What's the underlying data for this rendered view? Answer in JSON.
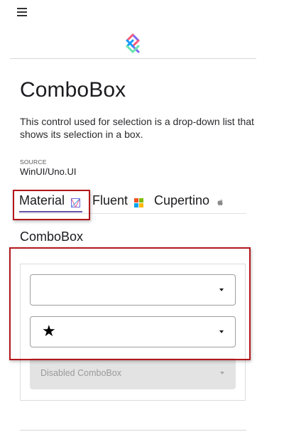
{
  "header": {
    "menu_icon": "hamburger-icon",
    "logo_icon": "uno-platform-logo"
  },
  "page": {
    "title": "ComboBox",
    "description": "This control used for selection is a drop-down list that shows its selection in a box.",
    "source_label": "SOURCE",
    "source_value": "WinUI/Uno.UI"
  },
  "tabs": [
    {
      "label": "Material",
      "icon": "material-icon",
      "selected": true
    },
    {
      "label": "Fluent",
      "icon": "windows-logo-icon",
      "selected": false
    },
    {
      "label": "Cupertino",
      "icon": "apple-logo-icon",
      "selected": false
    }
  ],
  "section": {
    "title": "ComboBox"
  },
  "comboboxes": [
    {
      "value": "",
      "icon": "chevron-down-icon",
      "enabled": true
    },
    {
      "value": "",
      "leading_icon": "star-icon",
      "icon": "chevron-down-icon",
      "enabled": true
    },
    {
      "placeholder": "Disabled ComboBox",
      "icon": "chevron-down-icon",
      "enabled": false
    }
  ],
  "colors": {
    "accent": "#6750a4",
    "highlight": "#b3171c",
    "disabled_fill": "#e3e3e3"
  }
}
